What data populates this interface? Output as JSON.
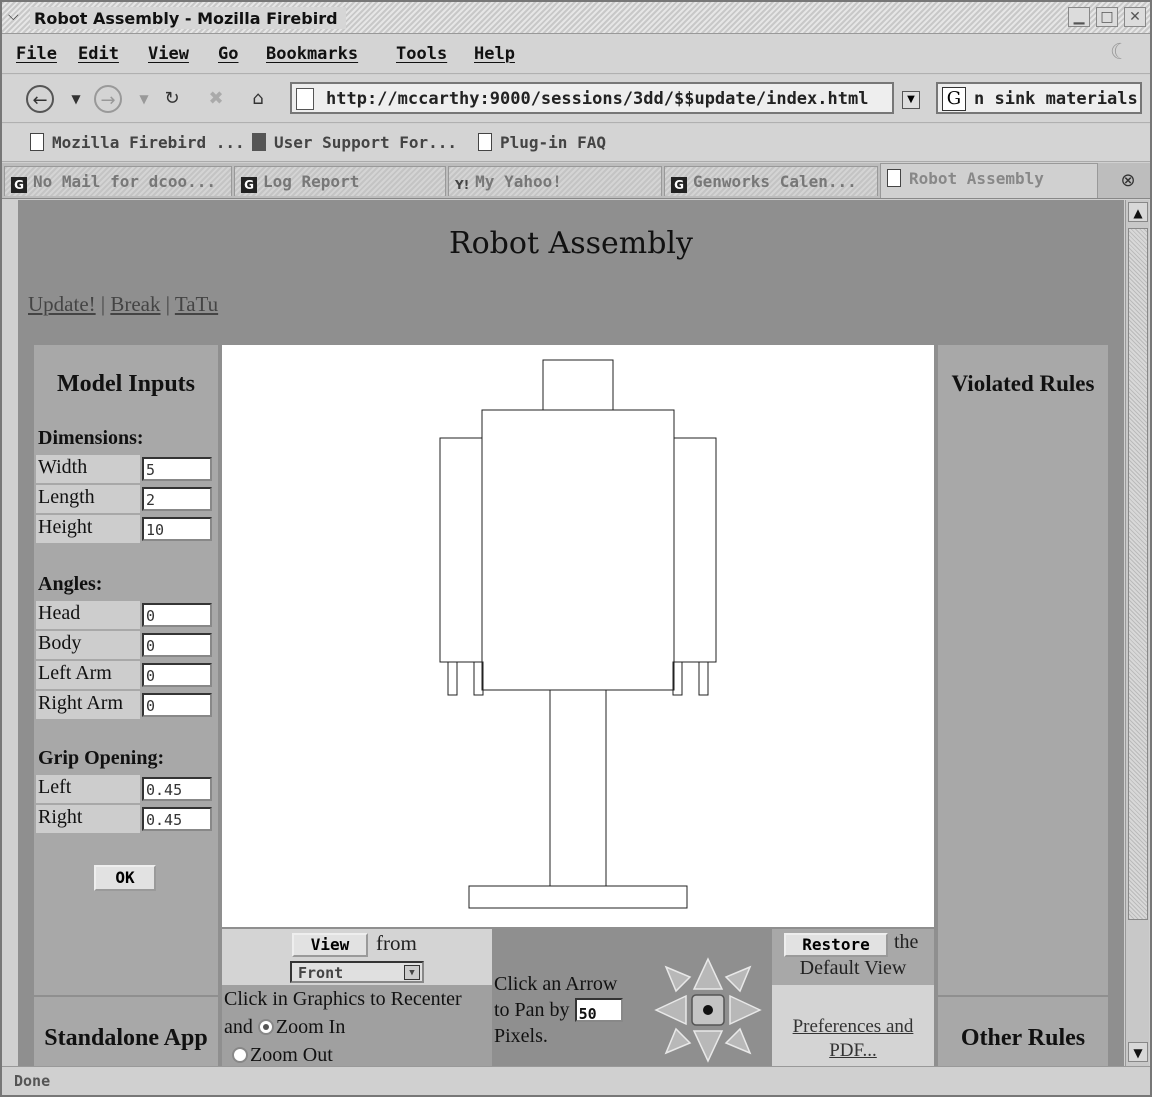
{
  "window": {
    "title": "Robot Assembly - Mozilla Firebird",
    "controls": [
      "minimize-icon",
      "maximize-icon",
      "close-icon"
    ]
  },
  "menu": [
    "File",
    "Edit",
    "View",
    "Go",
    "Bookmarks",
    "Tools",
    "Help"
  ],
  "nav": {
    "url": "http://mccarthy:9000/sessions/3dd/$$update/index.html",
    "search_value": "n sink materials"
  },
  "bookmarks": [
    "Mozilla Firebird ...",
    "User Support For...",
    "Plug-in FAQ"
  ],
  "tabs": [
    {
      "label": "No Mail for dcoo...",
      "icon": "g-icon"
    },
    {
      "label": "Log Report",
      "icon": "g-icon"
    },
    {
      "label": "My Yahoo!",
      "icon": "yahoo-icon"
    },
    {
      "label": "Genworks Calen...",
      "icon": "g-icon"
    },
    {
      "label": "Robot Assembly",
      "icon": "page-icon",
      "active": true
    }
  ],
  "page": {
    "title": "Robot Assembly",
    "links": [
      "Update!",
      "Break",
      "TaTu"
    ],
    "link_sep": "|"
  },
  "inputs": {
    "heading": "Model Inputs",
    "dimensions_label": "Dimensions:",
    "dimensions": [
      {
        "label": "Width",
        "value": "5"
      },
      {
        "label": "Length",
        "value": "2"
      },
      {
        "label": "Height",
        "value": "10"
      }
    ],
    "angles_label": "Angles:",
    "angles": [
      {
        "label": "Head",
        "value": "0"
      },
      {
        "label": "Body",
        "value": "0"
      },
      {
        "label": "Left Arm",
        "value": "0"
      },
      {
        "label": "Right Arm",
        "value": "0"
      }
    ],
    "grip_label": "Grip Opening:",
    "grip": [
      {
        "label": "Left",
        "value": "0.45"
      },
      {
        "label": "Right",
        "value": "0.45"
      }
    ],
    "ok_label": "OK"
  },
  "right": {
    "violated_heading": "Violated Rules",
    "other_heading": "Other Rules"
  },
  "standalone_heading": "Standalone App",
  "view_controls": {
    "view_button": "View",
    "from_text": "from",
    "view_option": "Front",
    "recenter_text": "Click in Graphics to Recenter and",
    "zoom_in": "Zoom In",
    "zoom_out": "Zoom Out",
    "zoom_selected": "Zoom In",
    "pan_text_1": "Click an Arrow",
    "pan_text_2": "to Pan by",
    "pan_value": "50",
    "pan_text_3": "Pixels.",
    "restore_button": "Restore",
    "restore_the": "the",
    "restore_default": "Default View",
    "prefs_link_1": "Preferences and",
    "prefs_link_2": "PDF..."
  },
  "status": "Done"
}
